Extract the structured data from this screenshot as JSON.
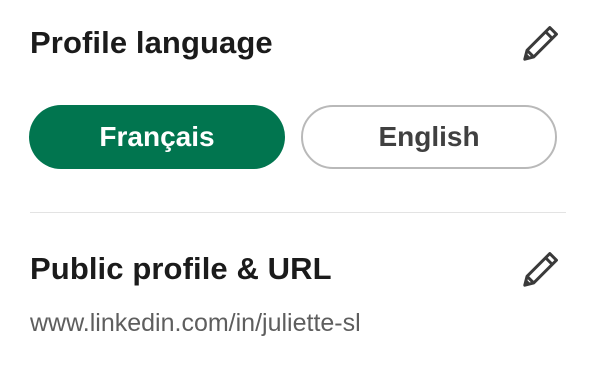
{
  "profile_language": {
    "title": "Profile language",
    "edit_icon": "pencil-icon",
    "options": [
      {
        "label": "Français",
        "selected": true
      },
      {
        "label": "English",
        "selected": false
      }
    ]
  },
  "public_profile": {
    "title": "Public profile & URL",
    "edit_icon": "pencil-icon",
    "url": "www.linkedin.com/in/juliette-sl"
  },
  "colors": {
    "accent": "#01754f",
    "title_text": "#1b1b1b",
    "secondary_text": "#5e5e5e",
    "divider": "#e3e3e3",
    "pill_border": "#b9b9b9"
  }
}
